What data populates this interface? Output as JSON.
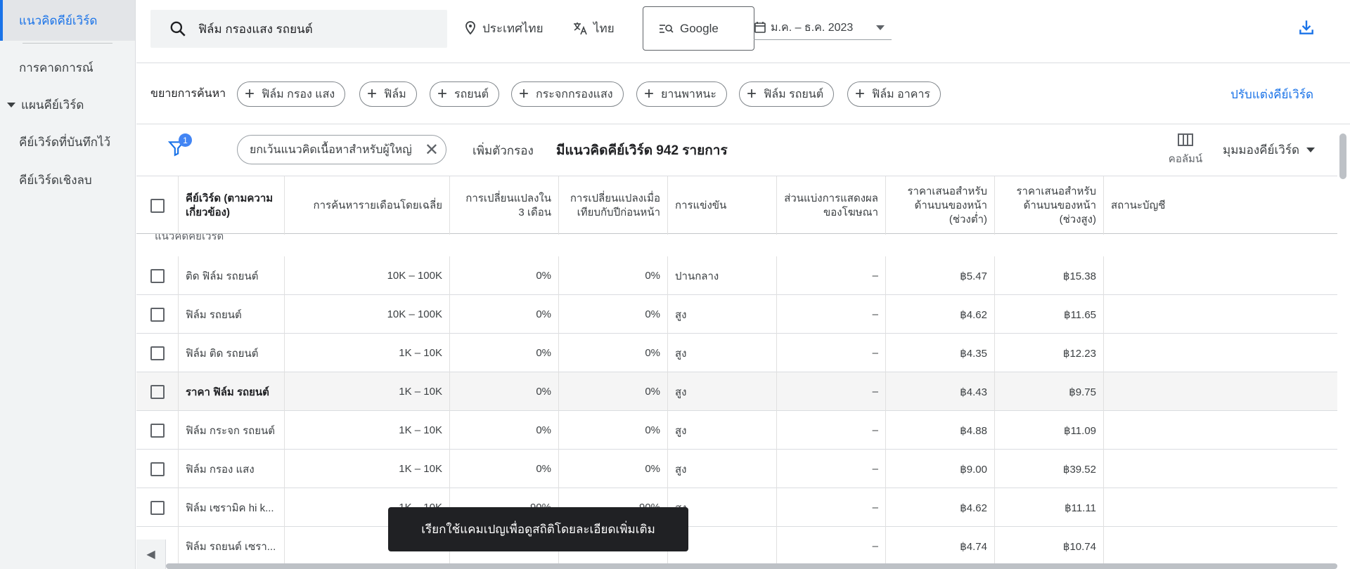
{
  "sidebar": {
    "items": [
      {
        "label": "แนวคิดคีย์เวิร์ด",
        "active": true
      },
      {
        "label": "การคาดการณ์"
      },
      {
        "label": "แผนคีย์เวิร์ด",
        "expandable": true
      },
      {
        "label": "คีย์เวิร์ดที่บันทึกไว้"
      },
      {
        "label": "คีย์เวิร์ดเชิงลบ"
      }
    ]
  },
  "topbar": {
    "search_value": "ฟิล์ม กรองแสง รถยนต์",
    "location": "ประเทศไทย",
    "language": "ไทย",
    "network": "Google",
    "date_range": "ม.ค. – ธ.ค. 2023"
  },
  "expand": {
    "label": "ขยายการค้นหา",
    "chips": [
      "ฟิล์ม กรอง แสง",
      "ฟิล์ม",
      "รถยนต์",
      "กระจกกรองแสง",
      "ยานพาหนะ",
      "ฟิล์ม รถยนต์",
      "ฟิล์ม อาคาร"
    ],
    "refine_label": "ปรับแต่งคีย์เวิร์ด"
  },
  "filters": {
    "badge_count": "1",
    "active_filter": "ยกเว้นแนวคิดเนื้อหาสำหรับผู้ใหญ่",
    "add_filter": "เพิ่มตัวกรอง",
    "result_count": "มีแนวคิดคีย์เวิร์ด 942 รายการ",
    "columns_label": "คอลัมน์",
    "view_label": "มุมมองคีย์เวิร์ด"
  },
  "table": {
    "headers": {
      "keyword": "คีย์เวิร์ด (ตามความเกี่ยวข้อง)",
      "searches": "การค้นหารายเดือนโดยเฉลี่ย",
      "change3m": "การเปลี่ยนแปลงใน 3 เดือน",
      "yoy": "การเปลี่ยนแปลงเมื่อเทียบกับปีก่อนหน้า",
      "competition": "การแข่งขัน",
      "share": "ส่วนแบ่งการแสดงผลของโฆษณา",
      "bid_low": "ราคาเสนอสำหรับด้านบนของหน้า (ช่วงต่ำ)",
      "bid_high": "ราคาเสนอสำหรับด้านบนของหน้า (ช่วงสูง)",
      "status": "สถานะบัญชี"
    },
    "group_label": "แนวคิดคีย์เวิร์ด",
    "rows": [
      {
        "kw": "ติด ฟิล์ม รถยนต์",
        "searches": "10K – 100K",
        "c3": "0%",
        "yoy": "0%",
        "comp": "ปานกลาง",
        "share": "–",
        "low": "฿5.47",
        "high": "฿15.38"
      },
      {
        "kw": "ฟิล์ม รถยนต์",
        "searches": "10K – 100K",
        "c3": "0%",
        "yoy": "0%",
        "comp": "สูง",
        "share": "–",
        "low": "฿4.62",
        "high": "฿11.65"
      },
      {
        "kw": "ฟิล์ม ติด รถยนต์",
        "searches": "1K – 10K",
        "c3": "0%",
        "yoy": "0%",
        "comp": "สูง",
        "share": "–",
        "low": "฿4.35",
        "high": "฿12.23"
      },
      {
        "kw": "ราคา ฟิล์ม รถยนต์",
        "searches": "1K – 10K",
        "c3": "0%",
        "yoy": "0%",
        "comp": "สูง",
        "share": "–",
        "low": "฿4.43",
        "high": "฿9.75",
        "highlight": true
      },
      {
        "kw": "ฟิล์ม กระจก รถยนต์",
        "searches": "1K – 10K",
        "c3": "0%",
        "yoy": "0%",
        "comp": "สูง",
        "share": "–",
        "low": "฿4.88",
        "high": "฿11.09"
      },
      {
        "kw": "ฟิล์ม กรอง แสง",
        "searches": "1K – 10K",
        "c3": "0%",
        "yoy": "0%",
        "comp": "สูง",
        "share": "–",
        "low": "฿9.00",
        "high": "฿39.52"
      },
      {
        "kw": "ฟิล์ม เซรามิค hi k...",
        "searches": "1K – 10K",
        "c3": "-90%",
        "yoy": "-90%",
        "comp": "สูง",
        "share": "–",
        "low": "฿4.62",
        "high": "฿11.11"
      },
      {
        "kw": "ฟิล์ม รถยนต์ เซรา...",
        "searches": "1K – 10K",
        "c3": "",
        "yoy": "",
        "comp": "",
        "share": "–",
        "low": "฿4.74",
        "high": "฿10.74"
      }
    ]
  },
  "toast": "เรียกใช้แคมเปญเพื่อดูสถิติโดยละเอียดเพิ่มเติม"
}
